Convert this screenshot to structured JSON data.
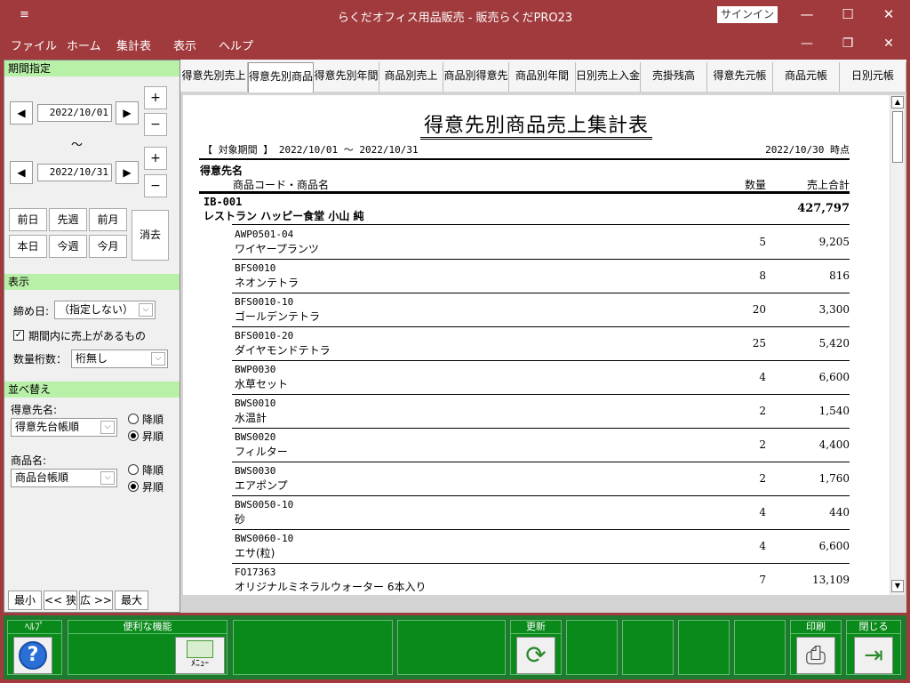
{
  "window": {
    "title": "らくだオフィス用品販売 - 販売らくだPRO23",
    "signin_label": "サインイン",
    "menu_glyph": "≡",
    "min_glyph": "—",
    "max_glyph": "☐",
    "close_glyph": "✕"
  },
  "menubar": {
    "items": [
      "ファイル",
      "ホーム",
      "集計表",
      "表示",
      "ヘルプ"
    ],
    "mdi_min": "—",
    "mdi_restore": "❐",
    "mdi_close": "✕"
  },
  "left": {
    "period_section": "期間指定",
    "date_from": "2022/10/01",
    "date_to": "2022/10/31",
    "tilde": "～",
    "prev_glyph": "◀",
    "next_glyph": "▶",
    "plus": "+",
    "minus": "−",
    "quick_buttons": [
      "前日",
      "先週",
      "前月",
      "本日",
      "今週",
      "今月"
    ],
    "clear_label": "消去",
    "display_section": "表示",
    "closing_day_label": "締め日:",
    "closing_day_value": "（指定しない）",
    "has_sales_label": "期間内に売上があるもの",
    "has_sales_checked": true,
    "qty_digits_label": "数量桁数：",
    "qty_digits_value": "桁無し",
    "sort_section": "並べ替え",
    "customer_sort_label": "得意先名:",
    "customer_sort_value": "得意先台帳順",
    "product_sort_label": "商品名:",
    "product_sort_value": "商品台帳順",
    "desc_label": "降順",
    "asc_label": "昇順",
    "zoom": [
      "最小",
      "<< 狭",
      "広 >>",
      "最大"
    ],
    "combo_glyph": "⌵"
  },
  "tabs": [
    "得意先別売上",
    "得意先別商品",
    "得意先別年間",
    "商品別売上",
    "商品別得意先",
    "商品別年間",
    "日別売上入金",
    "売掛残高",
    "得意先元帳",
    "商品元帳",
    "日別元帳"
  ],
  "active_tab": 1,
  "report": {
    "title": "得意先別商品売上集計表",
    "period": "【 対象期間 】 2022/10/01 ～ 2022/10/31",
    "as_of": "2022/10/30 時点",
    "col_customer": "得意先名",
    "col_product": "商品コード・商品名",
    "col_qty": "数量",
    "col_amount": "売上合計",
    "customer_code": "IB-001",
    "customer_name": "レストラン ハッピー食堂 小山 純",
    "customer_total": "427,797",
    "rows": [
      {
        "code": "AWP0501-04",
        "name": "ワイヤープランツ",
        "qty": "5",
        "amount": "9,205"
      },
      {
        "code": "BFS0010",
        "name": "ネオンテトラ",
        "qty": "8",
        "amount": "816"
      },
      {
        "code": "BFS0010-10",
        "name": "ゴールデンテトラ",
        "qty": "20",
        "amount": "3,300"
      },
      {
        "code": "BFS0010-20",
        "name": "ダイヤモンドテトラ",
        "qty": "25",
        "amount": "5,420"
      },
      {
        "code": "BWP0030",
        "name": "水草セット",
        "qty": "4",
        "amount": "6,600"
      },
      {
        "code": "BWS0010",
        "name": "水温計",
        "qty": "2",
        "amount": "1,540"
      },
      {
        "code": "BWS0020",
        "name": "フィルター",
        "qty": "2",
        "amount": "4,400"
      },
      {
        "code": "BWS0030",
        "name": "エアポンプ",
        "qty": "2",
        "amount": "1,760"
      },
      {
        "code": "BWS0050-10",
        "name": "砂",
        "qty": "4",
        "amount": "440"
      },
      {
        "code": "BWS0060-10",
        "name": "エサ(粒)",
        "qty": "4",
        "amount": "6,600"
      },
      {
        "code": "FO17363",
        "name": "オリジナルミネラルウォーター 6本入り",
        "qty": "7",
        "amount": "13,109"
      }
    ]
  },
  "bottom": {
    "help_label": "ﾍﾙﾌﾟ",
    "util_label": "便利な機能",
    "menu_label": "ﾒﾆｭｰ",
    "refresh_label": "更新",
    "print_label": "印刷",
    "close_label": "閉じる",
    "help_glyph": "?",
    "refresh_glyph": "⟳",
    "print_glyph": "⎙",
    "exit_glyph": "⇥"
  },
  "colors": {
    "titlebar": "#a03a3c",
    "section_header": "#b8f0a8",
    "toolbar": "#0a8a1a"
  }
}
